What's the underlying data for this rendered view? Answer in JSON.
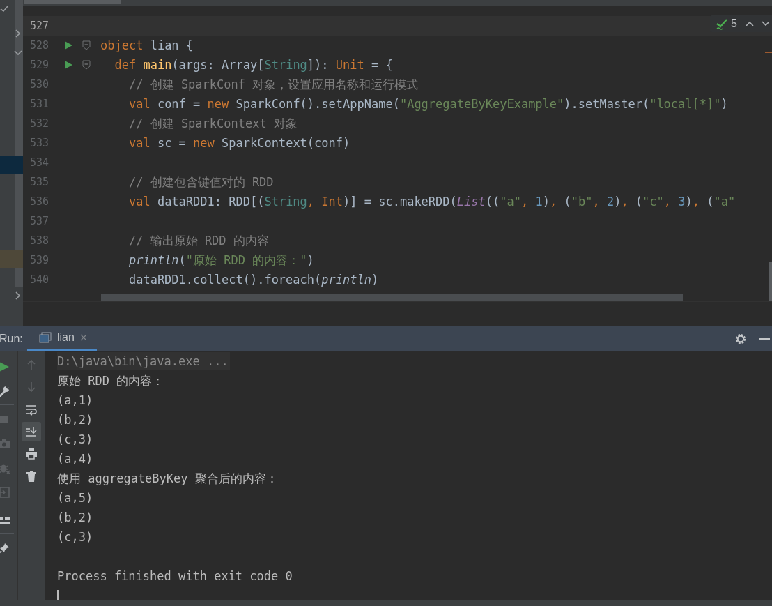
{
  "editor": {
    "inspections": {
      "count": "5"
    },
    "lines": [
      {
        "number": "527",
        "current": true,
        "runnable": false,
        "foldable": false
      },
      {
        "number": "528",
        "current": false,
        "runnable": true,
        "foldable": true,
        "tokens": [
          {
            "kind": "keyword",
            "text": "object"
          },
          {
            "kind": "plain",
            "text": " lian {"
          }
        ],
        "children": [
          {
            "number": "529",
            "current": false,
            "runnable": true,
            "foldable": true,
            "tokens": [
              {
                "kind": "keyword",
                "text": "def "
              },
              {
                "kind": "function",
                "text": "main"
              },
              {
                "kind": "plain",
                "text": "(args: Array["
              },
              {
                "kind": "type",
                "text": "String"
              },
              {
                "kind": "plain",
                "text": "]): "
              },
              {
                "kind": "keyword",
                "text": "Unit"
              },
              {
                "kind": "plain",
                "text": " = {"
              }
            ],
            "children": [
              {
                "number": "530",
                "current": false,
                "runnable": false,
                "foldable": false,
                "tokens": [
                  {
                    "kind": "comment",
                    "text": "// 创建 SparkConf 对象，设置应用名称和运行模式"
                  }
                ]
              },
              {
                "number": "531",
                "current": false,
                "runnable": false,
                "foldable": false,
                "tokens": [
                  {
                    "kind": "keyword",
                    "text": "val"
                  },
                  {
                    "kind": "plain",
                    "text": " conf = "
                  },
                  {
                    "kind": "keyword",
                    "text": "new"
                  },
                  {
                    "kind": "plain",
                    "text": " SparkConf().setAppName("
                  },
                  {
                    "kind": "string",
                    "text": "\"AggregateByKeyExample\""
                  },
                  {
                    "kind": "plain",
                    "text": ").setMaster("
                  },
                  {
                    "kind": "string",
                    "text": "\"local[*]\""
                  },
                  {
                    "kind": "plain",
                    "text": ")"
                  }
                ]
              },
              {
                "number": "532",
                "current": false,
                "runnable": false,
                "foldable": false,
                "tokens": [
                  {
                    "kind": "comment",
                    "text": "// 创建 SparkContext 对象"
                  }
                ]
              },
              {
                "number": "533",
                "current": false,
                "runnable": false,
                "foldable": false,
                "tokens": [
                  {
                    "kind": "keyword",
                    "text": "val"
                  },
                  {
                    "kind": "plain",
                    "text": " sc = "
                  },
                  {
                    "kind": "keyword",
                    "text": "new"
                  },
                  {
                    "kind": "plain",
                    "text": " SparkContext(conf)"
                  }
                ]
              },
              {
                "number": "534",
                "current": false,
                "runnable": false,
                "foldable": false
              },
              {
                "number": "535",
                "current": false,
                "runnable": false,
                "foldable": false,
                "tokens": [
                  {
                    "kind": "comment",
                    "text": "// 创建包含键值对的 RDD"
                  }
                ]
              },
              {
                "number": "536",
                "current": false,
                "runnable": false,
                "foldable": false,
                "tokens": [
                  {
                    "kind": "keyword",
                    "text": "val"
                  },
                  {
                    "kind": "plain",
                    "text": " dataRDD1: RDD[("
                  },
                  {
                    "kind": "type",
                    "text": "String"
                  },
                  {
                    "kind": "keyword",
                    "text": ", Int"
                  },
                  {
                    "kind": "plain",
                    "text": ")] = sc.makeRDD("
                  },
                  {
                    "kind": "builtin",
                    "text": "List"
                  },
                  {
                    "kind": "plain",
                    "text": "(("
                  },
                  {
                    "kind": "string",
                    "text": "\"a\""
                  },
                  {
                    "kind": "keyword",
                    "text": ", "
                  },
                  {
                    "kind": "number",
                    "text": "1"
                  },
                  {
                    "kind": "plain",
                    "text": ")"
                  },
                  {
                    "kind": "keyword",
                    "text": ", "
                  },
                  {
                    "kind": "plain",
                    "text": "("
                  },
                  {
                    "kind": "string",
                    "text": "\"b\""
                  },
                  {
                    "kind": "keyword",
                    "text": ", "
                  },
                  {
                    "kind": "number",
                    "text": "2"
                  },
                  {
                    "kind": "plain",
                    "text": ")"
                  },
                  {
                    "kind": "keyword",
                    "text": ", "
                  },
                  {
                    "kind": "plain",
                    "text": "("
                  },
                  {
                    "kind": "string",
                    "text": "\"c\""
                  },
                  {
                    "kind": "keyword",
                    "text": ", "
                  },
                  {
                    "kind": "number",
                    "text": "3"
                  },
                  {
                    "kind": "plain",
                    "text": ")"
                  },
                  {
                    "kind": "keyword",
                    "text": ", "
                  },
                  {
                    "kind": "plain",
                    "text": "("
                  },
                  {
                    "kind": "string",
                    "text": "\"a\""
                  }
                ]
              },
              {
                "number": "537",
                "current": false,
                "runnable": false,
                "foldable": false
              },
              {
                "number": "538",
                "current": false,
                "runnable": false,
                "foldable": false,
                "tokens": [
                  {
                    "kind": "comment",
                    "text": "// 输出原始 RDD 的内容"
                  }
                ]
              },
              {
                "number": "539",
                "current": false,
                "runnable": false,
                "foldable": false,
                "tokens": [
                  {
                    "kind": "call",
                    "text": "println"
                  },
                  {
                    "kind": "plain",
                    "text": "("
                  },
                  {
                    "kind": "string",
                    "text": "\"原始 RDD 的内容：\""
                  },
                  {
                    "kind": "plain",
                    "text": ")"
                  }
                ]
              },
              {
                "number": "540",
                "current": false,
                "runnable": false,
                "foldable": false,
                "tokens": [
                  {
                    "kind": "plain",
                    "text": "dataRDD1.collect().foreach("
                  },
                  {
                    "kind": "call",
                    "text": "println"
                  },
                  {
                    "kind": "plain",
                    "text": ")"
                  }
                ]
              }
            ]
          }
        ]
      }
    ]
  },
  "run_panel": {
    "label": "Run:",
    "tabs": [
      {
        "label": "lian",
        "selected": true
      }
    ],
    "side_tools": [
      {
        "kind": "rerun",
        "disabled": false
      },
      {
        "kind": "wrench",
        "disabled": false
      },
      {
        "kind": "stop",
        "disabled": true
      },
      {
        "kind": "camera",
        "disabled": true
      },
      {
        "kind": "bug",
        "disabled": true
      },
      {
        "kind": "exit",
        "disabled": true
      },
      {
        "kind": "layout",
        "disabled": false
      },
      {
        "kind": "pin",
        "disabled": false
      }
    ],
    "console_tools": [
      {
        "kind": "up",
        "disabled": true,
        "selected": false
      },
      {
        "kind": "down",
        "disabled": true,
        "selected": false
      },
      {
        "kind": "wrap",
        "disabled": false,
        "selected": false
      },
      {
        "kind": "scroll-end",
        "disabled": false,
        "selected": true
      },
      {
        "kind": "print",
        "disabled": false,
        "selected": false
      },
      {
        "kind": "trash",
        "disabled": false,
        "selected": false
      }
    ],
    "console": [
      {
        "kind": "command",
        "text": "D:\\java\\bin\\java.exe ..."
      },
      {
        "kind": "output",
        "text": "原始 RDD 的内容："
      },
      {
        "kind": "output",
        "text": "(a,1)"
      },
      {
        "kind": "output",
        "text": "(b,2)"
      },
      {
        "kind": "output",
        "text": "(c,3)"
      },
      {
        "kind": "output",
        "text": "(a,4)"
      },
      {
        "kind": "output",
        "text": "使用 aggregateByKey 聚合后的内容："
      },
      {
        "kind": "output",
        "text": "(a,5)"
      },
      {
        "kind": "output",
        "text": "(b,2)"
      },
      {
        "kind": "output",
        "text": "(c,3)"
      },
      {
        "kind": "blank"
      },
      {
        "kind": "output",
        "text": "Process finished with exit code 0"
      }
    ]
  }
}
